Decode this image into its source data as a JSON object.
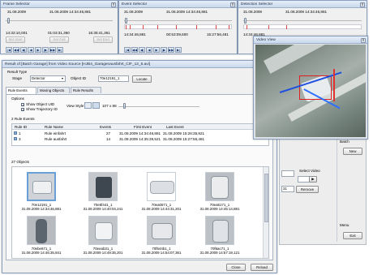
{
  "frame_selector": {
    "title": "Frame Selector",
    "date": "31.08.2009",
    "datetime": "31.08.2009 14:34:46,881",
    "start_time": "14:32:10,001",
    "mid_time": "01:03:31,360",
    "end_time": "15:35:41,361",
    "set_start": "Set Start",
    "set_full": "Set Full",
    "set_end": "Set End",
    "close_glyph": "x",
    "nav_glyphs": [
      "|◀",
      "◀◀",
      "◀|",
      "◀",
      "▶",
      "|▶",
      "▶▶",
      "▶|"
    ]
  },
  "event_selector": {
    "title": "Event Selector",
    "date": "31.08.2009",
    "datetime": "31.08.2009 14:34:46,881",
    "start_time": "14:34:46,881",
    "mid_time": "00:53:09,600",
    "end_time": "15:27:56,481",
    "close_glyph": "x"
  },
  "detection_selector": {
    "title": "Detection Selector",
    "date": "31.08.2009",
    "datetime": "31.08.2009 14:34:46,881",
    "start_time": "14:34:46,881",
    "close_glyph": "x"
  },
  "video_view": {
    "title": "Video View",
    "close_glyph": "x"
  },
  "right_panel": {
    "batch_label": "Batch",
    "new_button": "New",
    "select_video_label": "Select Video",
    "remove_button": "Remove",
    "field_value": "31",
    "play_glyph": "▶",
    "menu_label": "Menu",
    "exit_button": "Exit"
  },
  "result": {
    "title": "Result of [Batch Garage] from Video Source [HJB4_Garagenausfahrt_CIF_12_5.avi]",
    "close_glyph": "x",
    "result_type_label": "Result Type",
    "stage_label": "Stage",
    "stage_value": "Detector",
    "object_id_label": "Object ID",
    "object_id_value": "70e12191_1",
    "locate_button": "Locate",
    "tabs": [
      "Rule Events",
      "Moving Objects",
      "Rule Results"
    ],
    "options_label": "Options",
    "show_uid": "Show Object UID",
    "show_trajectory": "Show Trajectory ID",
    "view_style_label": "View Style",
    "view_size": "107 x 88",
    "rule_events_count": "2 Rule Events",
    "table_headers": [
      "Rule ID",
      "Rule Name",
      "Events",
      "First Event",
      "Last Event"
    ],
    "rows": [
      {
        "id": "1",
        "name": "Rule einfahrt",
        "events": "27",
        "first": "31.08.2009 14:34:46,881",
        "last": "31.08.2009 15:26:35,921"
      },
      {
        "id": "3",
        "name": "Rule ausfahrt",
        "events": "14",
        "first": "31.08.2009 14:35:39,521",
        "last": "31.08.2009 15:27:56,481"
      }
    ],
    "objects_count": "27 Objects",
    "objects": [
      {
        "id": "70e12191_1",
        "time": "31.08.2009 14:34:46,881"
      },
      {
        "id": "70e5f441_1",
        "time": "31.08.2009 14:40:04,241"
      },
      {
        "id": "70ea0671_1",
        "time": "31.08.2009 14:44:31,201"
      },
      {
        "id": "70ea5171_1",
        "time": "31.08.2009 14:45:14,881"
      },
      {
        "id": "70ebe671_1",
        "time": "31.08.2009 14:46:35,841"
      },
      {
        "id": "70eeab31_1",
        "time": "31.08.2009 14:49:35,201"
      },
      {
        "id": "70f544b1_1",
        "time": "31.08.2009 14:54:07,361"
      },
      {
        "id": "70f6ac71_1",
        "time": "31.08.2009 14:57:19,121"
      }
    ],
    "close_button": "Close",
    "reload_button": "Reload"
  }
}
